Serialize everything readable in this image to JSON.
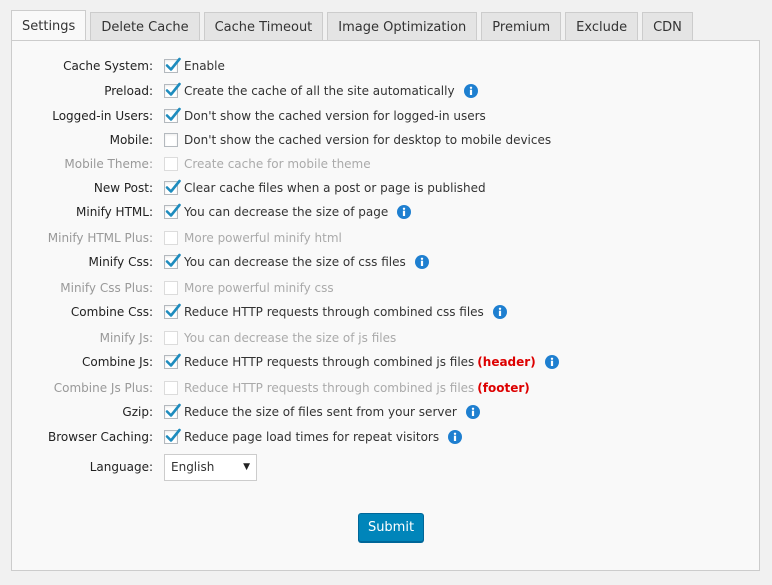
{
  "tabs": [
    "Settings",
    "Delete Cache",
    "Cache Timeout",
    "Image Optimization",
    "Premium",
    "Exclude",
    "CDN"
  ],
  "active_tab": "Settings",
  "rows": [
    {
      "label": "Cache System:",
      "text": "Enable",
      "checked": true,
      "disabled": false,
      "info": false,
      "note": ""
    },
    {
      "label": "Preload:",
      "text": "Create the cache of all the site automatically",
      "checked": true,
      "disabled": false,
      "info": true,
      "note": ""
    },
    {
      "label": "Logged-in Users:",
      "text": "Don't show the cached version for logged-in users",
      "checked": true,
      "disabled": false,
      "info": false,
      "note": ""
    },
    {
      "label": "Mobile:",
      "text": "Don't show the cached version for desktop to mobile devices",
      "checked": false,
      "disabled": false,
      "info": false,
      "note": ""
    },
    {
      "label": "Mobile Theme:",
      "text": "Create cache for mobile theme",
      "checked": false,
      "disabled": true,
      "info": false,
      "note": ""
    },
    {
      "label": "New Post:",
      "text": "Clear cache files when a post or page is published",
      "checked": true,
      "disabled": false,
      "info": false,
      "note": ""
    },
    {
      "label": "Minify HTML:",
      "text": "You can decrease the size of page",
      "checked": true,
      "disabled": false,
      "info": true,
      "note": ""
    },
    {
      "label": "Minify HTML Plus:",
      "text": "More powerful minify html",
      "checked": false,
      "disabled": true,
      "info": false,
      "note": ""
    },
    {
      "label": "Minify Css:",
      "text": "You can decrease the size of css files",
      "checked": true,
      "disabled": false,
      "info": true,
      "note": ""
    },
    {
      "label": "Minify Css Plus:",
      "text": "More powerful minify css",
      "checked": false,
      "disabled": true,
      "info": false,
      "note": ""
    },
    {
      "label": "Combine Css:",
      "text": "Reduce HTTP requests through combined css files",
      "checked": true,
      "disabled": false,
      "info": true,
      "note": ""
    },
    {
      "label": "Minify Js:",
      "text": "You can decrease the size of js files",
      "checked": false,
      "disabled": true,
      "info": false,
      "note": ""
    },
    {
      "label": "Combine Js:",
      "text": "Reduce HTTP requests through combined js files",
      "checked": true,
      "disabled": false,
      "info": true,
      "note": "(header)"
    },
    {
      "label": "Combine Js Plus:",
      "text": "Reduce HTTP requests through combined js files",
      "checked": false,
      "disabled": true,
      "info": false,
      "note": "(footer)"
    },
    {
      "label": "Gzip:",
      "text": "Reduce the size of files sent from your server",
      "checked": true,
      "disabled": false,
      "info": true,
      "note": ""
    },
    {
      "label": "Browser Caching:",
      "text": "Reduce page load times for repeat visitors",
      "checked": true,
      "disabled": false,
      "info": true,
      "note": ""
    }
  ],
  "language": {
    "label": "Language:",
    "selected": "English"
  },
  "submit_label": "Submit",
  "colors": {
    "accent": "#0085ba",
    "check": "#1e8cbe",
    "info": "#1e7fd0",
    "note": "#dd0000"
  },
  "icons": {
    "checkbox": "check-icon",
    "info": "info-icon",
    "dropdown": "caret-down-icon"
  }
}
